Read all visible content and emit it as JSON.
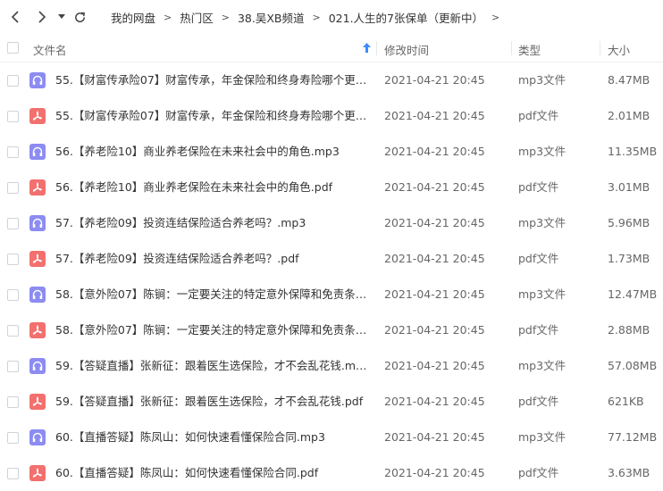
{
  "colors": {
    "audio_icon": "#8c8cf2",
    "pdf_icon": "#f2706e",
    "sort_arrow": "#3b8cff"
  },
  "toolbar": {
    "breadcrumbs": [
      "我的网盘",
      "热门区",
      "38.吴XB频道",
      "021.人生的7张保单（更新中）"
    ]
  },
  "columns": {
    "name": "文件名",
    "modified": "修改时间",
    "type": "类型",
    "size": "大小"
  },
  "files": [
    {
      "name": "55.【财富传承险07】财富传承，年金保险和终身寿险哪个更好....",
      "modified": "2021-04-21 20:45",
      "type": "mp3文件",
      "size": "8.47MB",
      "icon": "headphones-icon"
    },
    {
      "name": "55.【财富传承险07】财富传承，年金保险和终身寿险哪个更好....",
      "modified": "2021-04-21 20:45",
      "type": "pdf文件",
      "size": "2.01MB",
      "icon": "pdf-icon"
    },
    {
      "name": "56.【养老险10】商业养老保险在未来社会中的角色.mp3",
      "modified": "2021-04-21 20:45",
      "type": "mp3文件",
      "size": "11.35MB",
      "icon": "headphones-icon"
    },
    {
      "name": "56.【养老险10】商业养老保险在未来社会中的角色.pdf",
      "modified": "2021-04-21 20:45",
      "type": "pdf文件",
      "size": "3.01MB",
      "icon": "pdf-icon"
    },
    {
      "name": "57.【养老险09】投资连结保险适合养老吗？.mp3",
      "modified": "2021-04-21 20:45",
      "type": "mp3文件",
      "size": "5.96MB",
      "icon": "headphones-icon"
    },
    {
      "name": "57.【养老险09】投资连结保险适合养老吗？.pdf",
      "modified": "2021-04-21 20:45",
      "type": "pdf文件",
      "size": "1.73MB",
      "icon": "pdf-icon"
    },
    {
      "name": "58.【意外险07】陈锏：一定要关注的特定意外保障和免责条款....",
      "modified": "2021-04-21 20:45",
      "type": "mp3文件",
      "size": "12.47MB",
      "icon": "headphones-icon"
    },
    {
      "name": "58.【意外险07】陈锏：一定要关注的特定意外保障和免责条款....",
      "modified": "2021-04-21 20:45",
      "type": "pdf文件",
      "size": "2.88MB",
      "icon": "pdf-icon"
    },
    {
      "name": "59.【答疑直播】张新征：跟着医生选保险，才不会乱花钱.mp3",
      "modified": "2021-04-21 20:45",
      "type": "mp3文件",
      "size": "57.08MB",
      "icon": "headphones-icon"
    },
    {
      "name": "59.【答疑直播】张新征：跟着医生选保险，才不会乱花钱.pdf",
      "modified": "2021-04-21 20:45",
      "type": "pdf文件",
      "size": "621KB",
      "icon": "pdf-icon"
    },
    {
      "name": "60.【直播答疑】陈凤山：如何快速看懂保险合同.mp3",
      "modified": "2021-04-21 20:45",
      "type": "mp3文件",
      "size": "77.12MB",
      "icon": "headphones-icon"
    },
    {
      "name": "60.【直播答疑】陈凤山：如何快速看懂保险合同.pdf",
      "modified": "2021-04-21 20:45",
      "type": "pdf文件",
      "size": "3.63MB",
      "icon": "pdf-icon"
    }
  ]
}
